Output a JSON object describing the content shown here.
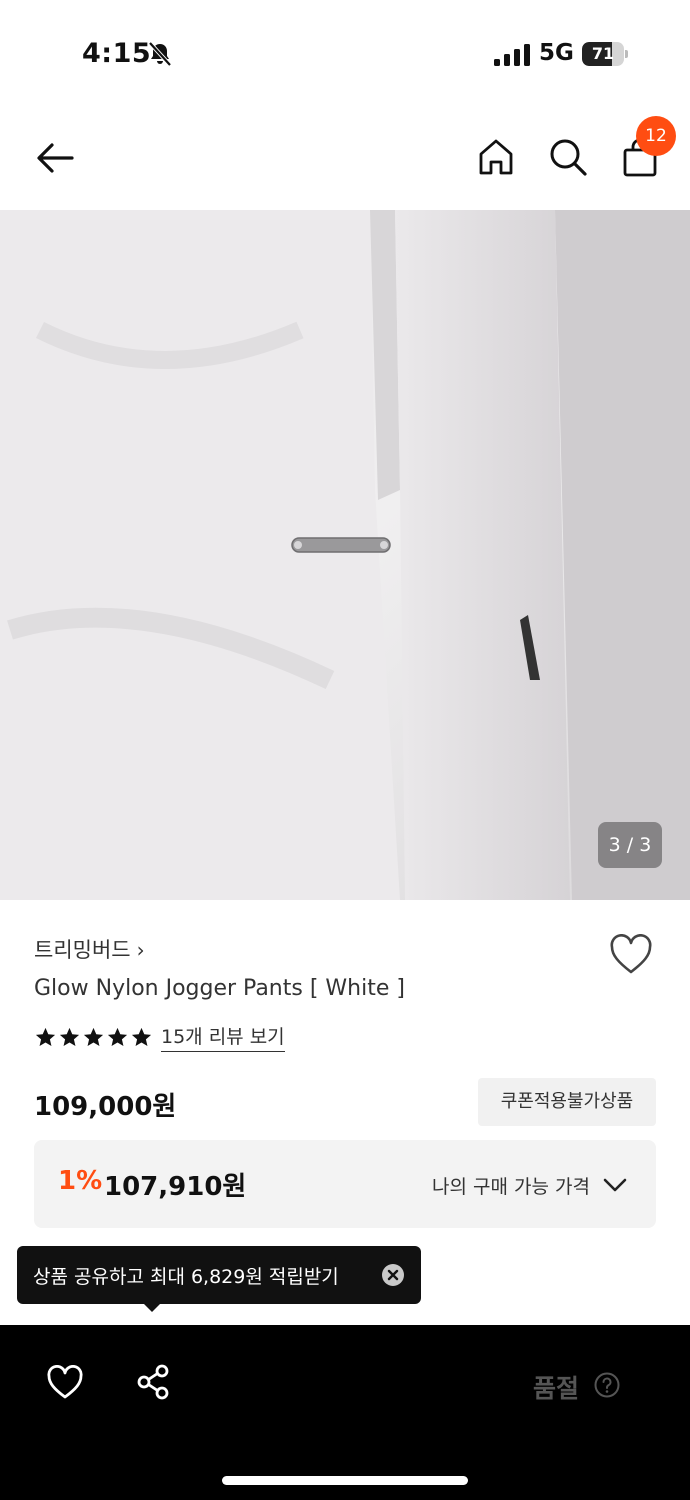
{
  "status_bar": {
    "time": "4:15",
    "network": "5G",
    "battery": "71",
    "battery_level": 0.71
  },
  "header": {
    "cart_count": "12"
  },
  "gallery": {
    "counter": "3 / 3"
  },
  "product": {
    "brand": "트리밍버드",
    "brand_chevron": "›",
    "title": "Glow Nylon Jogger Pants [ White ]",
    "rating_stars": 5,
    "review_link": "15개 리뷰 보기",
    "price": "109,000원",
    "coupon_badge": "쿠폰적용불가상품",
    "discount_rate": "1%",
    "discount_price": "107,910원",
    "my_price_label": "나의 구매 가능 가격"
  },
  "toast": {
    "text": "상품 공유하고 최대 6,829원 적립받기"
  },
  "bottom_bar": {
    "soldout_label": "품절"
  },
  "colors": {
    "accent": "#ff4d12",
    "bottom_bar_bg": "#000000"
  },
  "icons": [
    "bell-off-icon",
    "signal-icon",
    "battery-icon",
    "back-arrow-icon",
    "home-icon",
    "search-icon",
    "shopping-bag-icon",
    "heart-icon",
    "star-icon",
    "chevron-down-icon",
    "close-icon",
    "share-icon",
    "help-icon"
  ]
}
